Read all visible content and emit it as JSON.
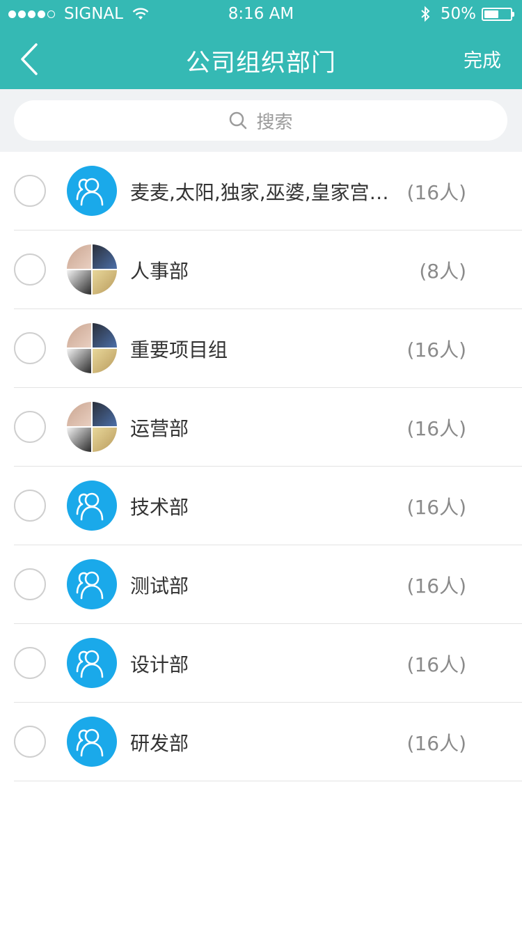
{
  "status": {
    "signal": "SIGNAL",
    "time": "8:16 AM",
    "battery": "50%"
  },
  "nav": {
    "title": "公司组织部门",
    "done_label": "完成"
  },
  "search": {
    "placeholder": "搜索"
  },
  "rows": [
    {
      "name": "麦麦,太阳,独家,巫婆,皇家宫廷,麦麦",
      "count": "(16人)",
      "avatar": "group"
    },
    {
      "name": "人事部",
      "count": "(8人)",
      "avatar": "photo"
    },
    {
      "name": "重要项目组",
      "count": "(16人)",
      "avatar": "photo"
    },
    {
      "name": "运营部",
      "count": "(16人)",
      "avatar": "photo"
    },
    {
      "name": "技术部",
      "count": "(16人)",
      "avatar": "group"
    },
    {
      "name": "测试部",
      "count": "(16人)",
      "avatar": "group"
    },
    {
      "name": "设计部",
      "count": "(16人)",
      "avatar": "group"
    },
    {
      "name": "研发部",
      "count": "(16人)",
      "avatar": "group"
    }
  ],
  "colors": {
    "header": "#35b9b4",
    "group_avatar": "#1aa9ea",
    "search_bg": "#f0f2f4"
  },
  "icons": {
    "back": "chevron-left-icon",
    "search": "search-icon",
    "group": "group-users-icon",
    "wifi": "wifi-icon",
    "bluetooth": "bluetooth-icon",
    "battery": "battery-icon"
  }
}
